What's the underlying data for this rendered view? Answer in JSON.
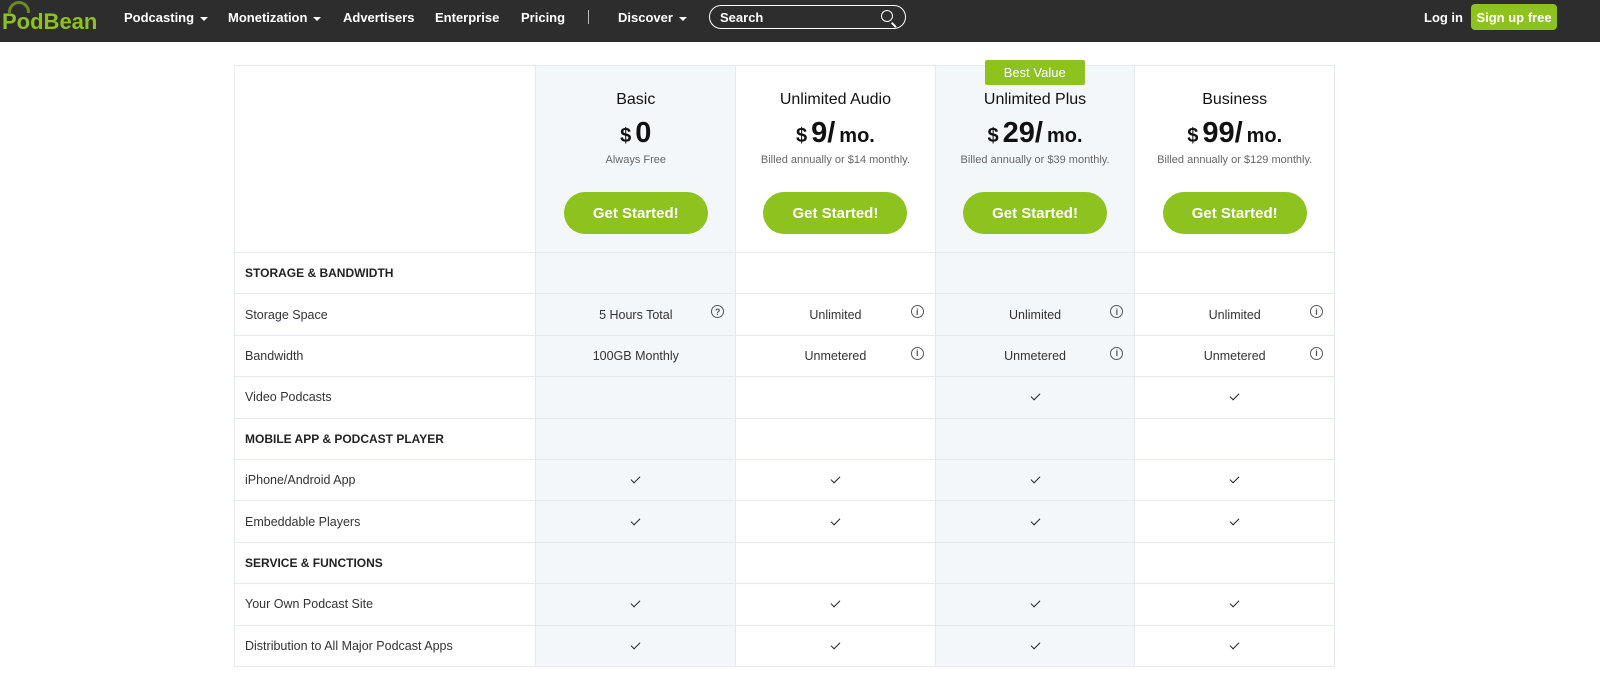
{
  "nav": {
    "logo": "PodBean",
    "items": [
      {
        "label": "Podcasting",
        "dropdown": true
      },
      {
        "label": "Monetization",
        "dropdown": true
      },
      {
        "label": "Advertisers"
      },
      {
        "label": "Enterprise"
      },
      {
        "label": "Pricing"
      },
      {
        "label": "Discover",
        "dropdown": true
      }
    ],
    "search_placeholder": "Search",
    "login": "Log in",
    "signup": "Sign up free"
  },
  "plans": [
    {
      "name": "Basic",
      "currency": "$",
      "amount": "0",
      "per": "",
      "note": "Always Free",
      "cta": "Get Started!",
      "shaded": true
    },
    {
      "name": "Unlimited Audio",
      "currency": "$",
      "amount": "9/",
      "per": "mo.",
      "note": "Billed annually or $14 monthly.",
      "cta": "Get Started!",
      "shaded": false
    },
    {
      "name": "Unlimited Plus",
      "currency": "$",
      "amount": "29/",
      "per": "mo.",
      "note": "Billed annually or $39 monthly.",
      "cta": "Get Started!",
      "shaded": true,
      "badge": "Best Value"
    },
    {
      "name": "Business",
      "currency": "$",
      "amount": "99/",
      "per": "mo.",
      "note": "Billed annually or $129 monthly.",
      "cta": "Get Started!",
      "shaded": false
    }
  ],
  "rows": [
    {
      "label": "STORAGE & BANDWIDTH",
      "section": true
    },
    {
      "label": "Storage Space",
      "values": [
        {
          "text": "5 Hours Total",
          "icon": "?"
        },
        {
          "text": "Unlimited",
          "icon": "i"
        },
        {
          "text": "Unlimited",
          "icon": "i"
        },
        {
          "text": "Unlimited",
          "icon": "i"
        }
      ]
    },
    {
      "label": "Bandwidth",
      "values": [
        {
          "text": "100GB Monthly"
        },
        {
          "text": "Unmetered",
          "icon": "i"
        },
        {
          "text": "Unmetered",
          "icon": "i"
        },
        {
          "text": "Unmetered",
          "icon": "i"
        }
      ]
    },
    {
      "label": "Video Podcasts",
      "values": [
        {},
        {},
        {
          "check": true
        },
        {
          "check": true
        }
      ]
    },
    {
      "label": "MOBILE APP & PODCAST PLAYER",
      "section": true
    },
    {
      "label": "iPhone/Android App",
      "values": [
        {
          "check": true
        },
        {
          "check": true
        },
        {
          "check": true
        },
        {
          "check": true
        }
      ]
    },
    {
      "label": "Embeddable Players",
      "values": [
        {
          "check": true
        },
        {
          "check": true
        },
        {
          "check": true
        },
        {
          "check": true
        }
      ]
    },
    {
      "label": "SERVICE & FUNCTIONS",
      "section": true
    },
    {
      "label": "Your Own Podcast Site",
      "values": [
        {
          "check": true
        },
        {
          "check": true
        },
        {
          "check": true
        },
        {
          "check": true
        }
      ]
    },
    {
      "label": "Distribution to All Major Podcast Apps",
      "values": [
        {
          "check": true
        },
        {
          "check": true
        },
        {
          "check": true
        },
        {
          "check": true
        }
      ]
    }
  ]
}
